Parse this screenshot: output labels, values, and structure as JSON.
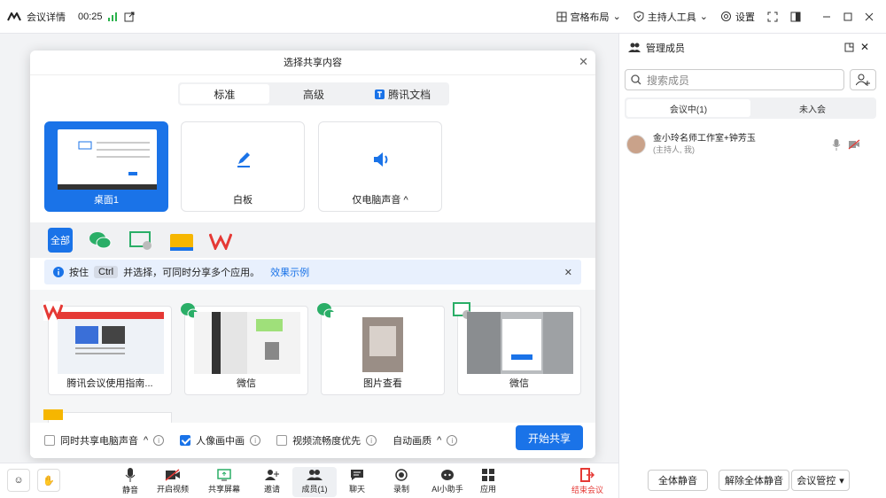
{
  "titlebar": {
    "meeting_details": "会议详情",
    "duration": "00:25",
    "grid_layout": "宫格布局",
    "host_tools": "主持人工具",
    "settings": "设置"
  },
  "dialog": {
    "title": "选择共享内容",
    "tabs": [
      "标准",
      "高级",
      "腾讯文档"
    ],
    "cards": {
      "desktop": "桌面1",
      "whiteboard": "白板",
      "audio": "仅电脑声音"
    },
    "filter_all": "全部",
    "notice": {
      "prefix": "按住",
      "key": "Ctrl",
      "text": "并选择，可同时分享多个应用。",
      "link": "效果示例"
    },
    "apps": [
      "腾讯会议使用指南...",
      "微信",
      "图片查看",
      "微信"
    ],
    "options": {
      "share_audio": "同时共享电脑声音",
      "pip": "人像画中画",
      "smooth": "视频流畅度优先",
      "auto_quality": "自动画质"
    },
    "start_button": "开始共享"
  },
  "bottombar": {
    "items": [
      "静音",
      "开启视频",
      "共享屏幕",
      "邀请",
      "成员(1)",
      "聊天",
      "录制",
      "AI小助手",
      "应用"
    ],
    "leave": "结束会议"
  },
  "panel": {
    "title": "管理成员",
    "search_placeholder": "搜索成员",
    "tabs": [
      "会议中(1)",
      "未入会"
    ],
    "member_name": "金小玲名师工作室+钟芳玉",
    "member_role": "(主持人, 我)",
    "buttons": {
      "mute_all": "全体静音",
      "unmute_all": "解除全体静音",
      "control": "会议管控"
    }
  },
  "colors": {
    "accent": "#1a73e8",
    "leave": "#e53935"
  }
}
